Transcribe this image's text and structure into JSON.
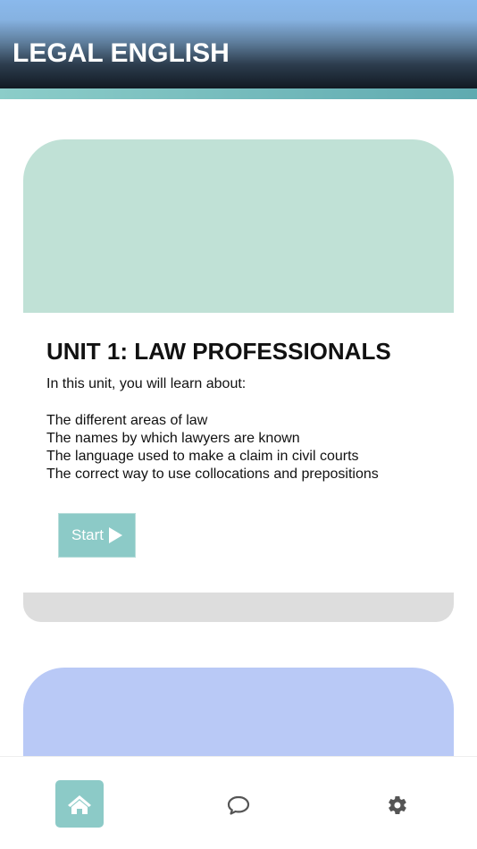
{
  "header": {
    "title": "LEGAL ENGLISH"
  },
  "units": [
    {
      "title": "UNIT 1: LAW PROFESSIONALS",
      "intro": "In this unit, you will learn about:",
      "topics": [
        "The different areas of law",
        "The names by which lawyers are known",
        "The language used to make a claim in civil courts",
        "The correct way to use collocations and prepositions"
      ],
      "start_label": "Start",
      "banner_color": "#c0e1d6"
    },
    {
      "banner_color": "#b9c9f6"
    }
  ],
  "nav": {
    "items": [
      {
        "icon": "home-icon",
        "active": true
      },
      {
        "icon": "chat-bubble-icon",
        "active": false
      },
      {
        "icon": "gear-icon",
        "active": false
      }
    ],
    "accent": "#8ccac7"
  }
}
